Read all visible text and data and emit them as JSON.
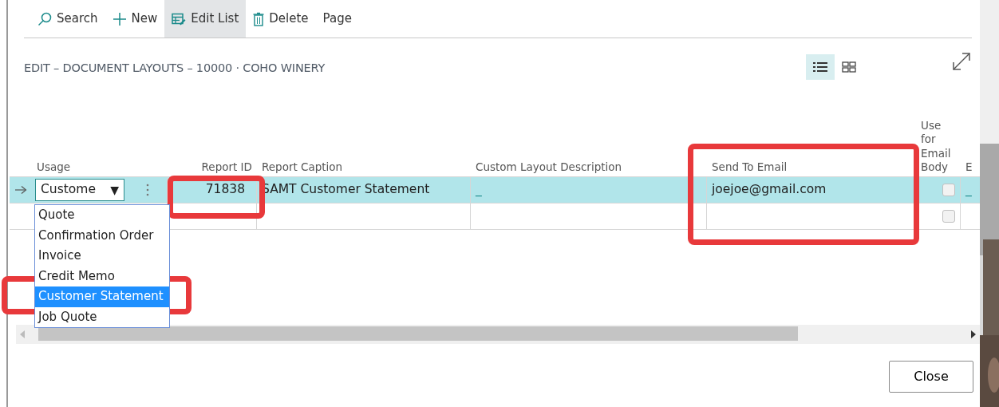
{
  "toolbar": {
    "actions": [
      {
        "kind": "search",
        "label": "Search",
        "selected": false
      },
      {
        "kind": "new",
        "label": "New",
        "selected": false
      },
      {
        "kind": "edit-list",
        "label": "Edit List",
        "selected": true
      },
      {
        "kind": "delete",
        "label": "Delete",
        "selected": false
      },
      {
        "kind": "plain",
        "label": "Page",
        "selected": false
      }
    ]
  },
  "title": "EDIT – DOCUMENT LAYOUTS – 10000 · COHO WINERY",
  "view_toggle": [
    {
      "kind": "list",
      "selected": true
    },
    {
      "kind": "tiles",
      "selected": false
    }
  ],
  "table": {
    "columns": [
      "Usage",
      "Report ID",
      "Report Caption",
      "Custom Layout Description",
      "Send To Email",
      "Use for Email Body",
      "E"
    ],
    "rows": [
      {
        "selected": true,
        "usage": "Custome",
        "caret": "▼",
        "report_id": "71838",
        "report_caption": "SAMT Customer Statement",
        "custom_layout_description": "_",
        "send_to_email": "joejoe@gmail.com",
        "use_for_email_body": false,
        "column_8": "_"
      },
      {
        "selected": false,
        "use_for_email_body": false
      }
    ]
  },
  "dropdown": {
    "options": [
      {
        "label": "Quote",
        "selected": false
      },
      {
        "label": "Confirmation Order",
        "selected": false
      },
      {
        "label": "Invoice",
        "selected": false
      },
      {
        "label": "Credit Memo",
        "selected": false
      },
      {
        "label": "Customer Statement",
        "selected": true
      },
      {
        "label": "Job Quote",
        "selected": false
      }
    ]
  },
  "buttons": [
    "Close"
  ]
}
